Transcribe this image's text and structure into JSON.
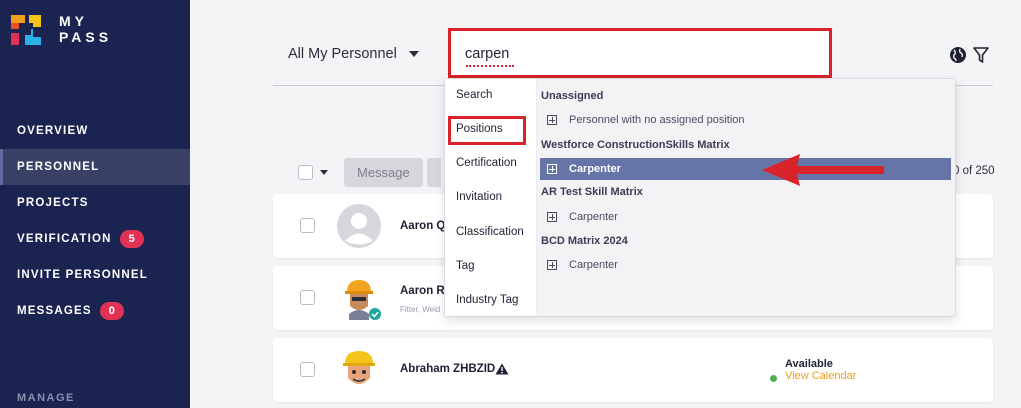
{
  "brand": {
    "line1": "MY",
    "line2": "PASS"
  },
  "sidebar": {
    "items": [
      {
        "label": "OVERVIEW"
      },
      {
        "label": "PERSONNEL"
      },
      {
        "label": "PROJECTS"
      },
      {
        "label": "VERIFICATION",
        "badge": "5"
      },
      {
        "label": "INVITE PERSONNEL"
      },
      {
        "label": "MESSAGES",
        "badge": "0"
      }
    ],
    "section_label": "MANAGE",
    "active_item": "PERSONNEL"
  },
  "header": {
    "filter_label": "All My Personnel",
    "search_value": "carpen",
    "icons": [
      "globe-icon",
      "filter-icon"
    ]
  },
  "toolbar": {
    "message_label": "Message",
    "count_text": "0 of 250"
  },
  "personnel": [
    {
      "name": "Aaron QF",
      "sub": ""
    },
    {
      "name": "Aaron Ro",
      "sub": "Fitter, Weld"
    },
    {
      "name": "Abraham ZHBZID",
      "status": "Available",
      "calendar_link": "View Calendar"
    }
  ],
  "dropdown": {
    "tabs": [
      "Search",
      "Positions",
      "Certification",
      "Invitation",
      "Classification",
      "Tag",
      "Industry Tag"
    ],
    "selected_tab": "Positions",
    "groups": [
      {
        "title": "Unassigned",
        "items": [
          "Personnel with no assigned position"
        ]
      },
      {
        "title": "Westforce ConstructionSkills Matrix",
        "items": [
          "Carpenter"
        ]
      },
      {
        "title": "AR Test Skill Matrix",
        "items": [
          "Carpenter"
        ]
      },
      {
        "title": "BCD Matrix 2024",
        "items": [
          "Carpenter"
        ]
      }
    ],
    "highlighted": "Westforce ConstructionSkills Matrix / Carpenter"
  },
  "colors": {
    "sidebar_bg": "#1b2350",
    "badge": "#e03254",
    "highlight": "#6675a7",
    "annotation_red": "#d8232a",
    "available_dot": "#4caf50",
    "calendar_link": "#f39c12"
  }
}
